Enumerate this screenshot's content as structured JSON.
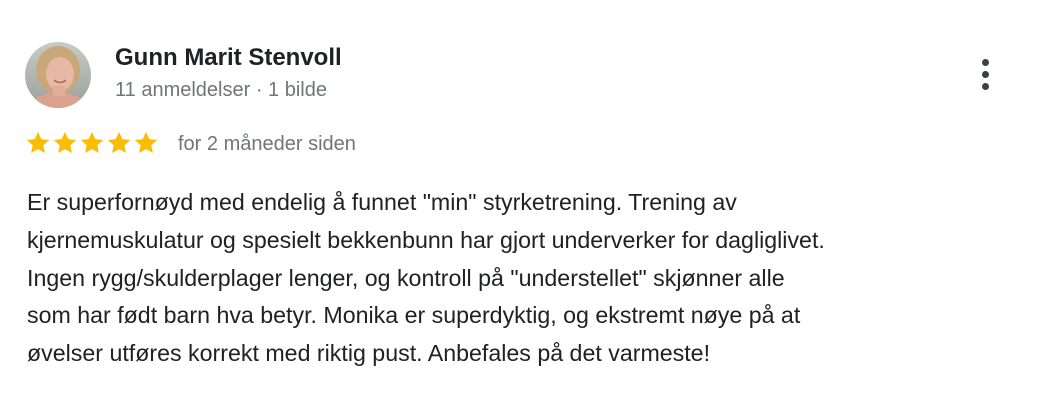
{
  "review": {
    "reviewer_name": "Gunn Marit Stenvoll",
    "reviewer_meta": "11 anmeldelser · 1 bilde",
    "rating": 5,
    "rating_max": 5,
    "time_ago": "for 2 måneder siden",
    "text": "Er superfornøyd med endelig å funnet \"min\" styrketrening. Trening av\nkjernemuskulatur og spesielt bekkenbunn har gjort underverker for dagliglivet.\nIngen rygg/skulderplager lenger, og kontroll på \"understellet\" skjønner alle\nsom har født barn hva betyr. Monika er superdyktig, og ekstremt nøye på at\nøvelser utføres korrekt med riktig pust. Anbefales på det varmeste!"
  },
  "icons": {
    "star": "star-icon",
    "more": "more-vert-icon"
  },
  "colors": {
    "star": "#fbbc04",
    "name": "#202124",
    "meta": "#70757a",
    "text": "#202124"
  }
}
